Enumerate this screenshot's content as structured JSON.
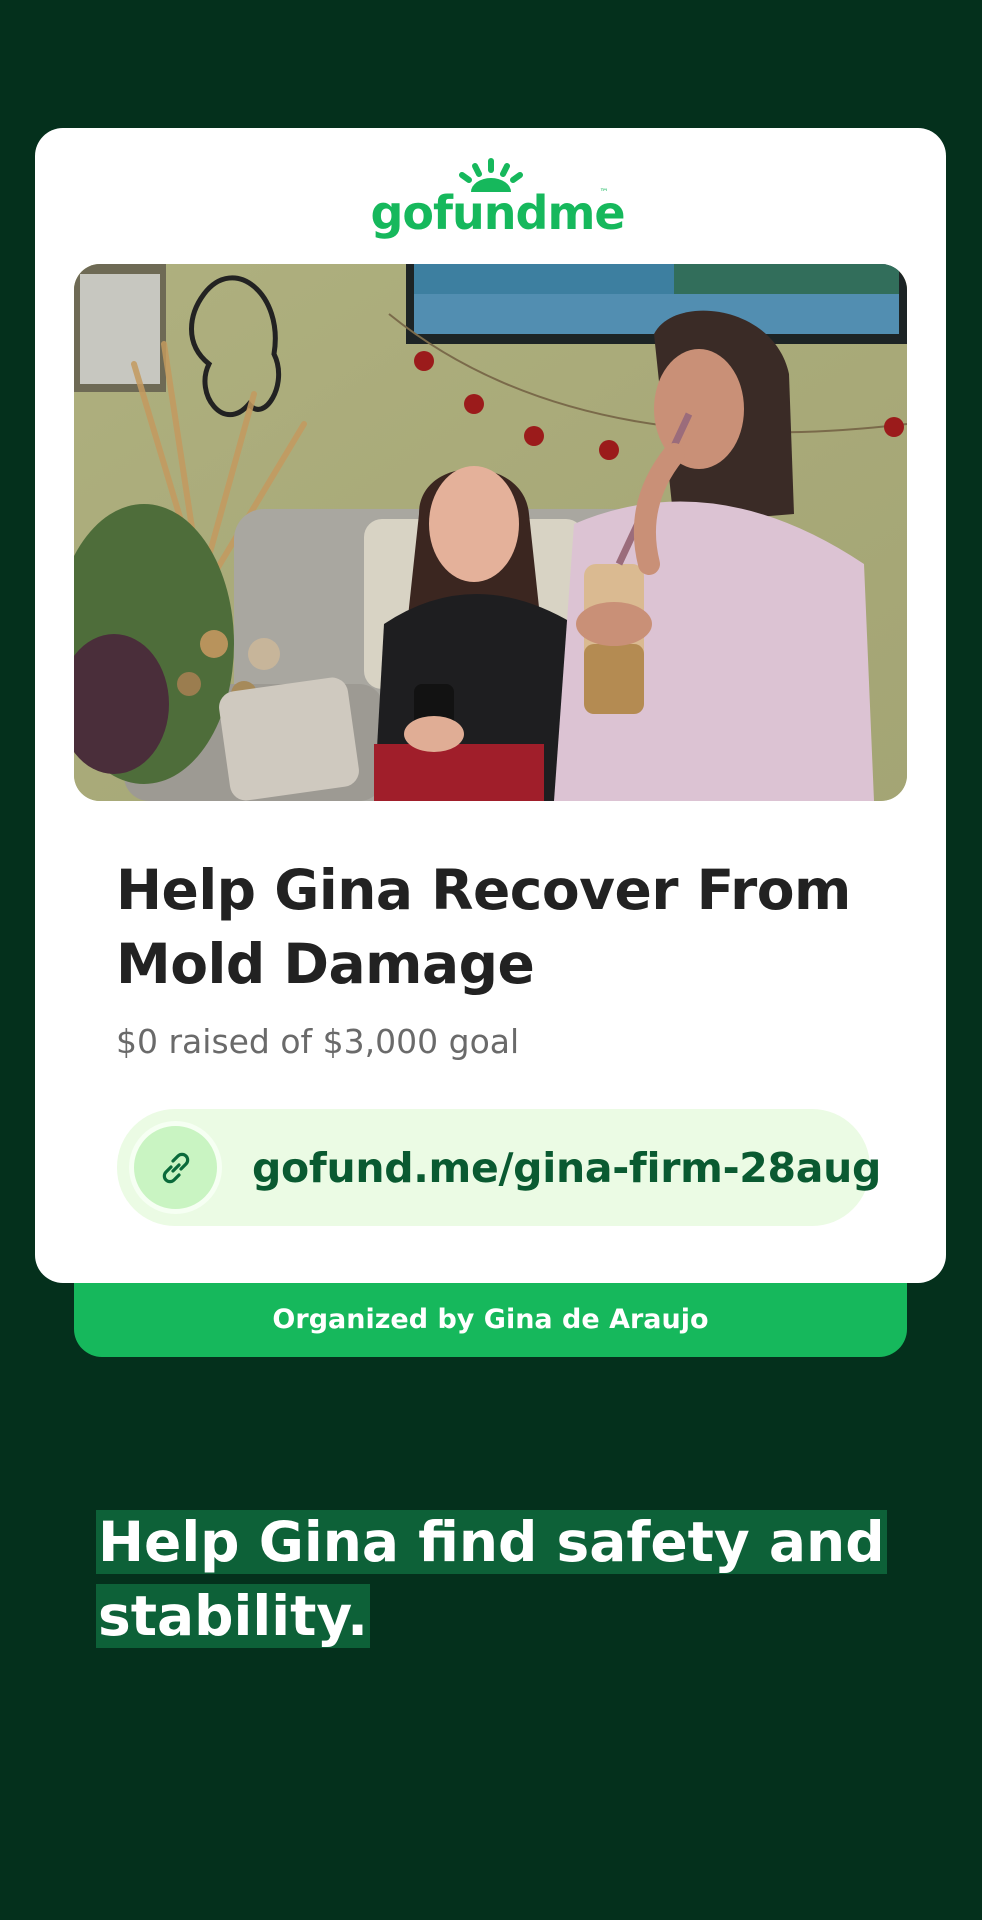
{
  "brand": {
    "logo_text": "gofundme",
    "trademark": "™",
    "color": "#16b85c"
  },
  "campaign": {
    "title": "Help Gina Recover From Mold Damage",
    "raised_text": "$0 raised of $3,000 goal",
    "raised_amount": 0,
    "goal_amount": 3000,
    "link": "gofund.me/gina-firm-28aug",
    "organizer_text": "Organized by Gina de Araujo"
  },
  "caption": {
    "line1": "Help Gina find safety and",
    "line2": "stability."
  },
  "colors": {
    "background": "#04301c",
    "card": "#ffffff",
    "accent": "#16b85c",
    "link_text": "#0a5a31",
    "caption_highlight": "#0d6138"
  },
  "icons": {
    "link": "link-icon",
    "logo_sun": "sun-rays-icon"
  }
}
